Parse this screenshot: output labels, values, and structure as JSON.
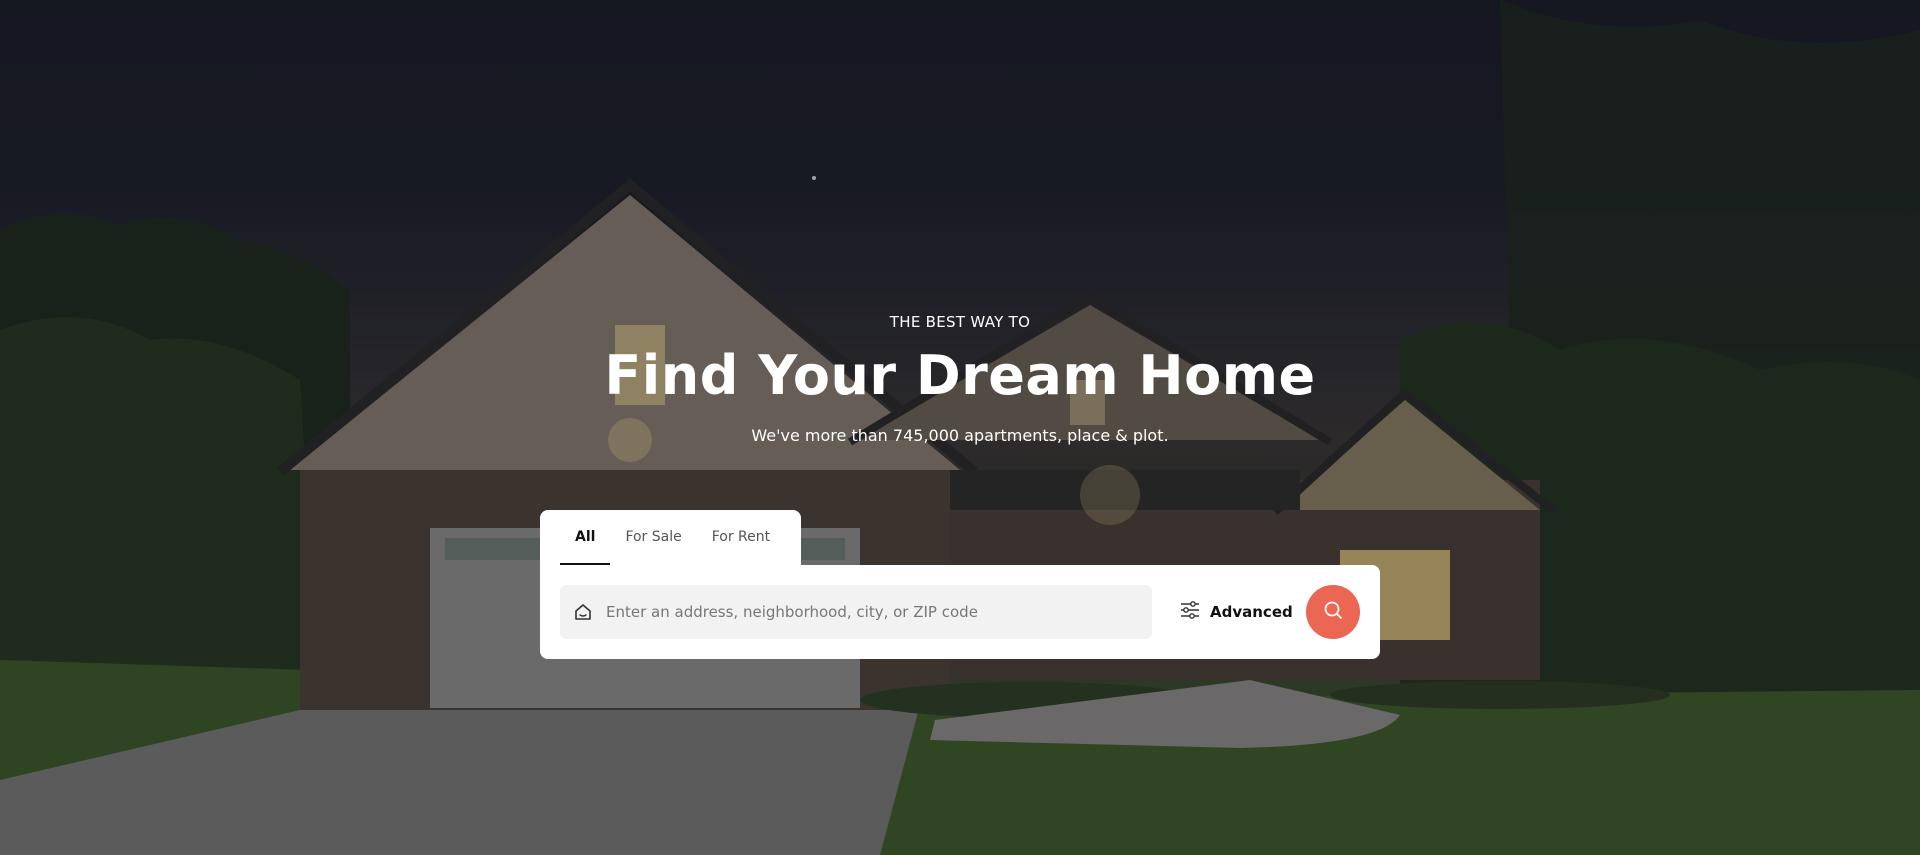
{
  "hero": {
    "kicker": "THE BEST WAY TO",
    "title": "Find Your Dream Home",
    "subtitle": "We've more than 745,000 apartments, place & plot."
  },
  "search": {
    "tabs": [
      {
        "label": "All",
        "active": true
      },
      {
        "label": "For Sale",
        "active": false
      },
      {
        "label": "For Rent",
        "active": false
      }
    ],
    "placeholder": "Enter an address, neighborhood, city, or ZIP code",
    "advanced_label": "Advanced",
    "field_icon": "home-icon",
    "advanced_icon": "sliders-icon",
    "button_icon": "search-icon"
  },
  "colors": {
    "accent": "#eb6753",
    "text_dark": "#111111",
    "panel": "#ffffff",
    "field_bg": "#f2f2f2"
  }
}
